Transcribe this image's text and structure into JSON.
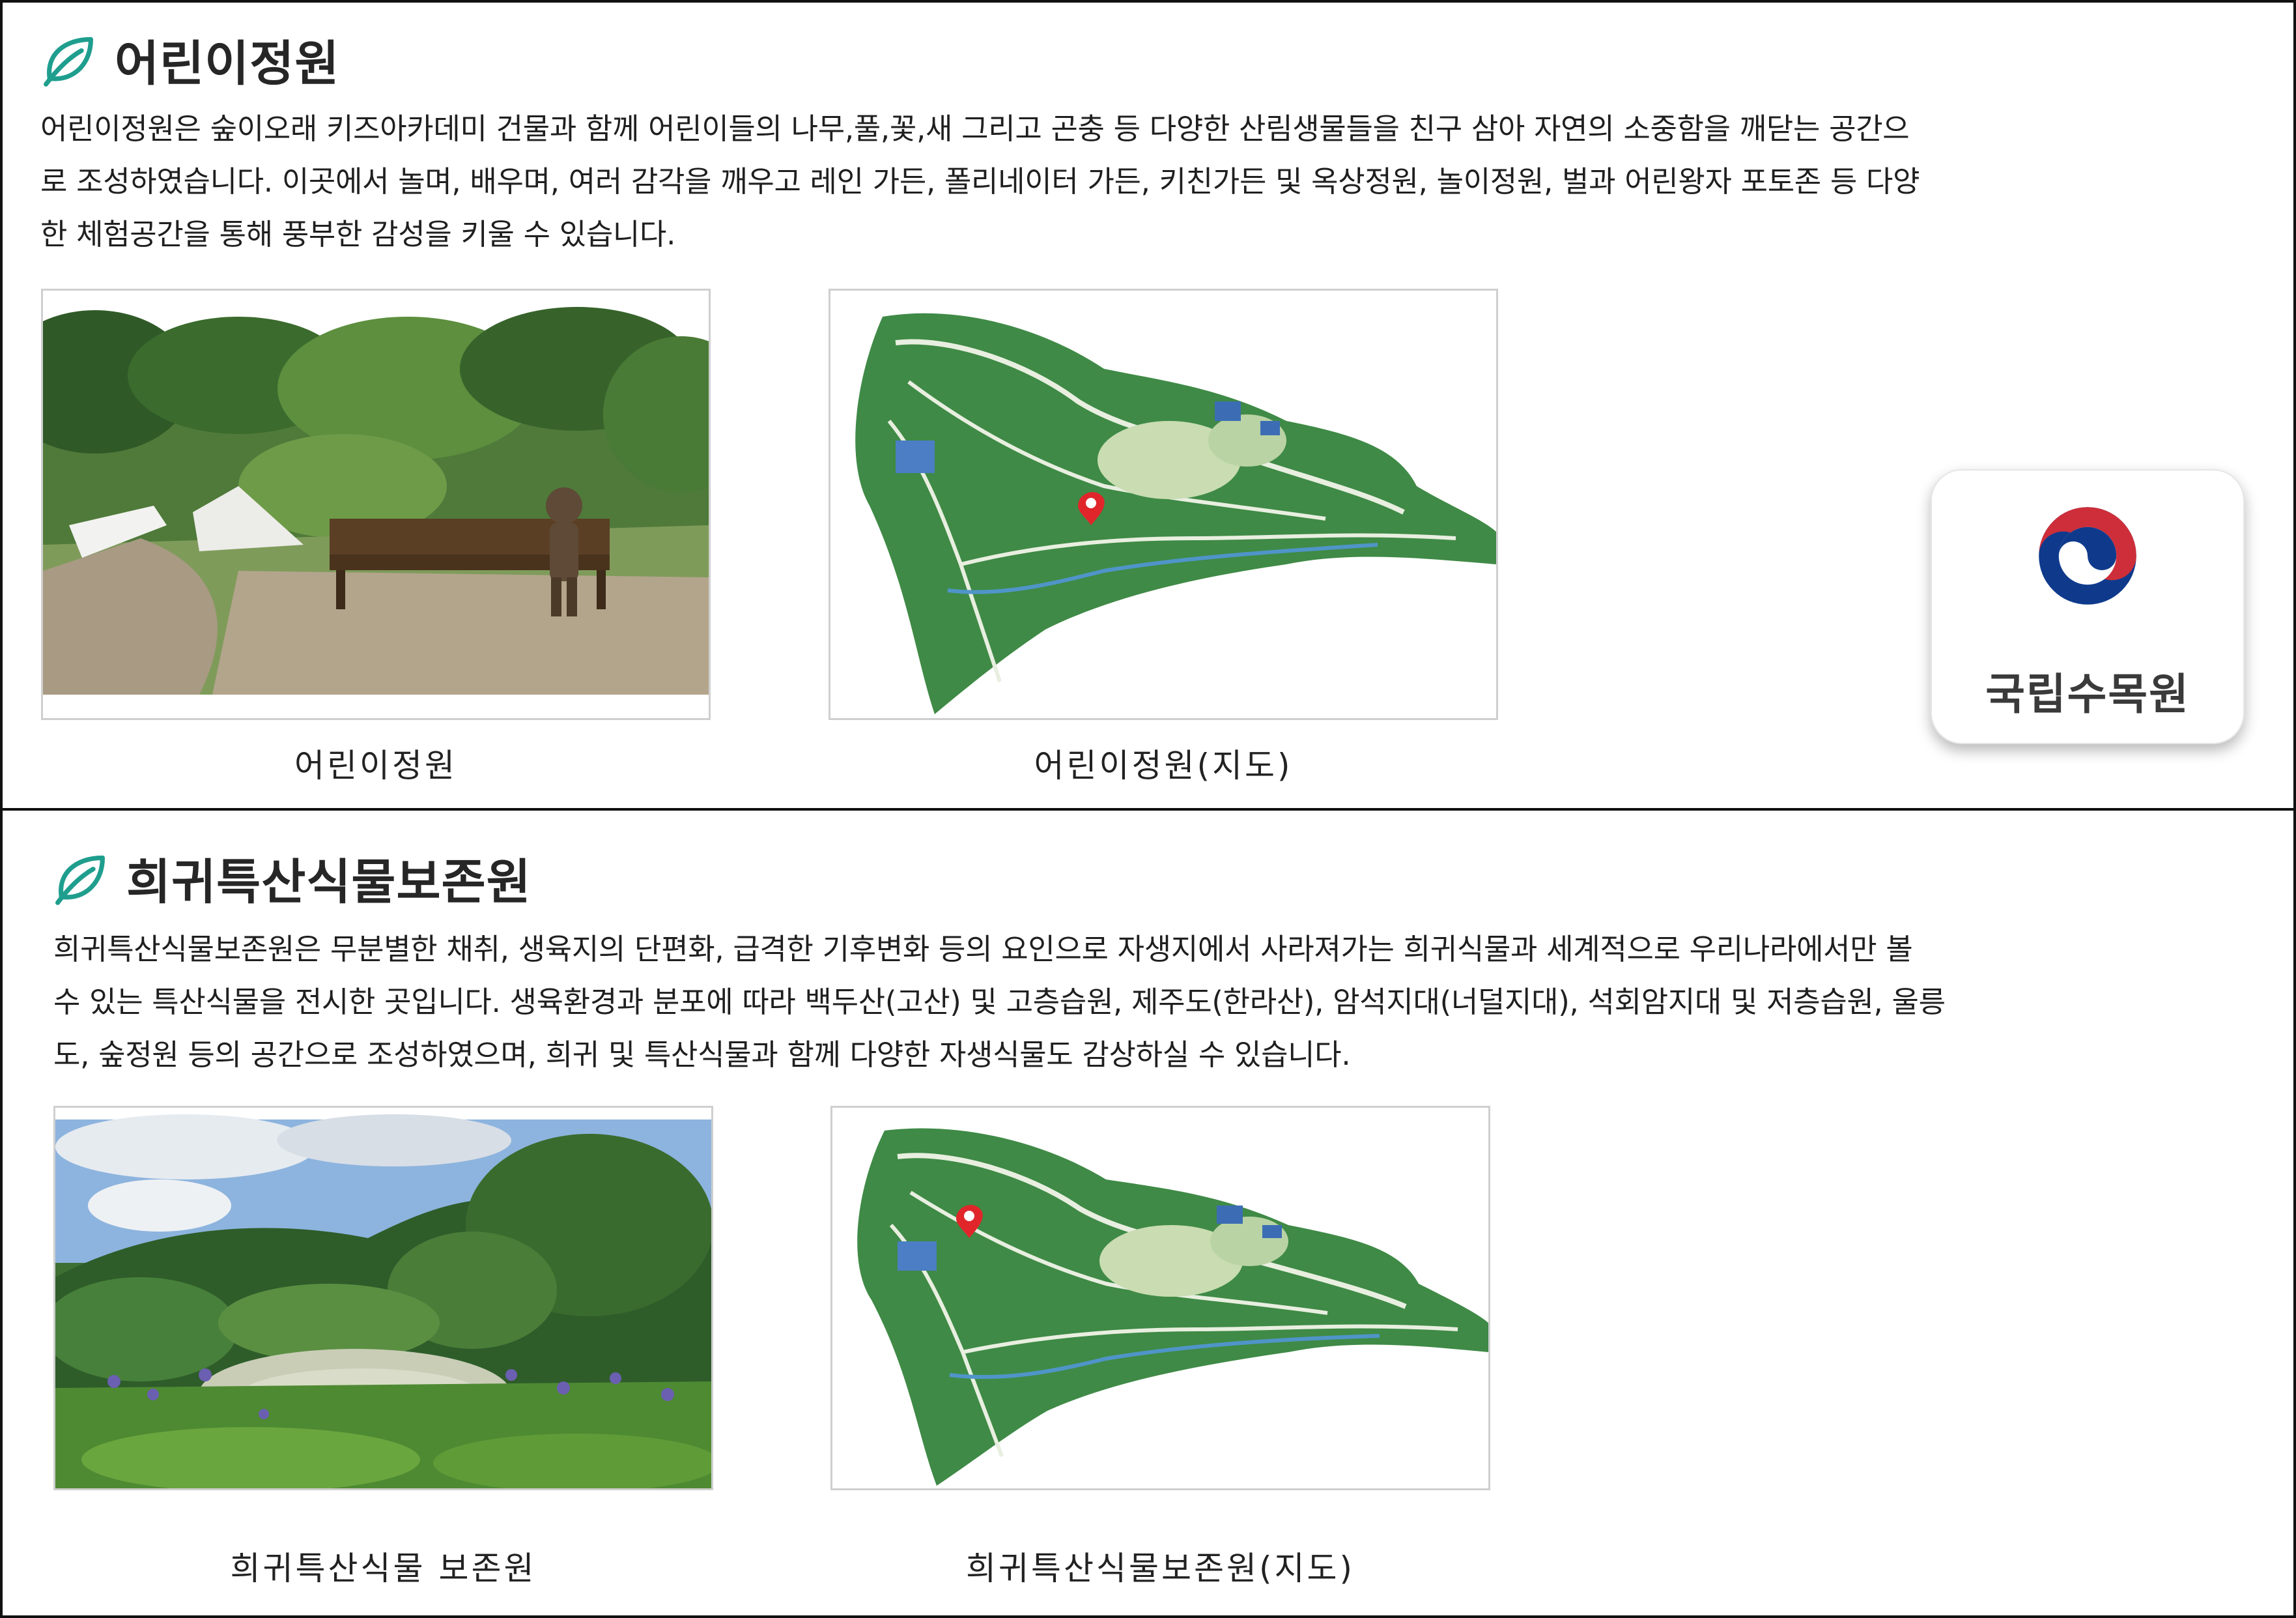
{
  "sections": [
    {
      "title": "어린이정원",
      "description_lines": [
        "어린이정원은 숲이오래 키즈아카데미 건물과 함께 어린이들의 나무,풀,꽃,새 그리고 곤충 등 다양한 산림생물들을 친구 삼아 자연의 소중함을 깨닫는 공간으",
        "로 조성하였습니다. 이곳에서 놀며, 배우며, 여러 감각을 깨우고 레인 가든, 폴리네이터 가든, 키친가든 및 옥상정원, 놀이정원, 벌과 어린왕자 포토존 등 다양",
        "한 체험공간을 통해 풍부한 감성을 키울 수 있습니다."
      ],
      "photo_caption": "어린이정원",
      "map_caption": "어린이정원(지도)"
    },
    {
      "title": "희귀특산식물보존원",
      "description_lines": [
        "희귀특산식물보존원은 무분별한 채취, 생육지의 단편화, 급격한 기후변화 등의 요인으로 자생지에서 사라져가는 희귀식물과 세계적으로 우리나라에서만 볼",
        "수 있는 특산식물을 전시한 곳입니다. 생육환경과 분포에 따라 백두산(고산) 및 고층습원, 제주도(한라산), 암석지대(너덜지대), 석회암지대 및 저층습원, 울릉",
        "도, 숲정원 등의 공간으로 조성하였으며, 희귀 및 특산식물과 함께 다양한 자생식물도 감상하실 수 있습니다."
      ],
      "photo_caption": "희귀특산식물 보존원",
      "map_caption": "희귀특산식물보존원(지도)"
    }
  ],
  "logo": {
    "text": "국립수목원",
    "icon": "taegeuk-icon"
  },
  "colors": {
    "leaf": "#1f9e8e",
    "map_forest": "#3f8a46",
    "map_marker": "#e0262b",
    "logo_red": "#cd2e3a",
    "logo_blue": "#0f3a8c"
  }
}
